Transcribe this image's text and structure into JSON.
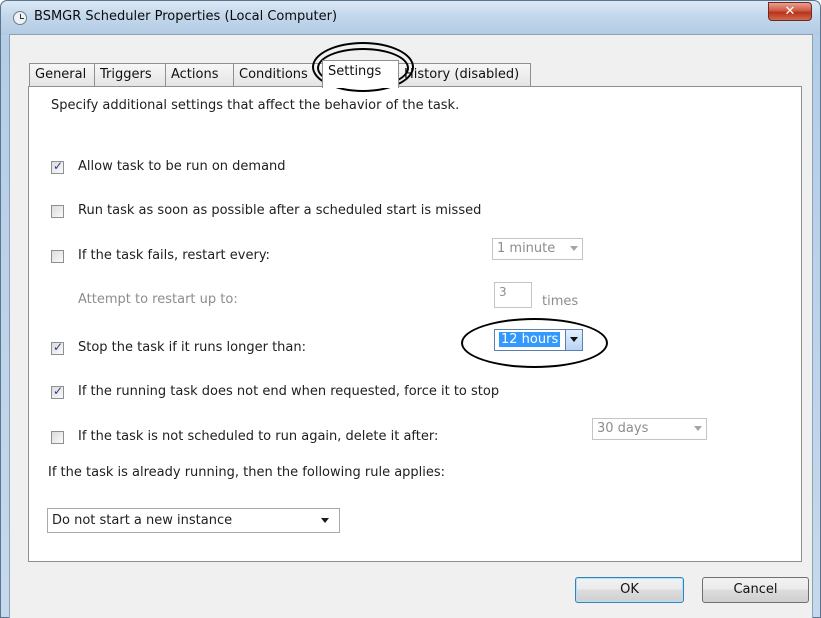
{
  "window": {
    "title": "BSMGR Scheduler Properties (Local Computer)",
    "close_glyph": "✕"
  },
  "tabs": [
    {
      "label": "General"
    },
    {
      "label": "Triggers"
    },
    {
      "label": "Actions"
    },
    {
      "label": "Conditions"
    },
    {
      "label": "Settings",
      "active": true
    },
    {
      "label": "History (disabled)"
    }
  ],
  "settings": {
    "description": "Specify additional settings that affect the behavior of the task.",
    "allow_on_demand": {
      "label": "Allow task to be run on demand",
      "checked": true
    },
    "run_asap": {
      "label": "Run task as soon as possible after a scheduled start is missed",
      "checked": false
    },
    "restart_on_fail": {
      "label": "If the task fails, restart every:",
      "checked": false,
      "interval": "1 minute"
    },
    "restart_attempts": {
      "label": "Attempt to restart up to:",
      "value": "3",
      "unit": "times"
    },
    "stop_if_longer": {
      "label": "Stop the task if it runs longer than:",
      "checked": true,
      "value": "12 hours"
    },
    "force_stop": {
      "label": "If the running task does not end when requested, force it to stop",
      "checked": true
    },
    "delete_after": {
      "label": "If the task is not scheduled to run again, delete it after:",
      "checked": false,
      "value": "30 days"
    },
    "running_rule": {
      "label": "If the task is already running, then the following rule applies:",
      "value": "Do not start a new instance"
    }
  },
  "buttons": {
    "ok": "OK",
    "cancel": "Cancel"
  }
}
